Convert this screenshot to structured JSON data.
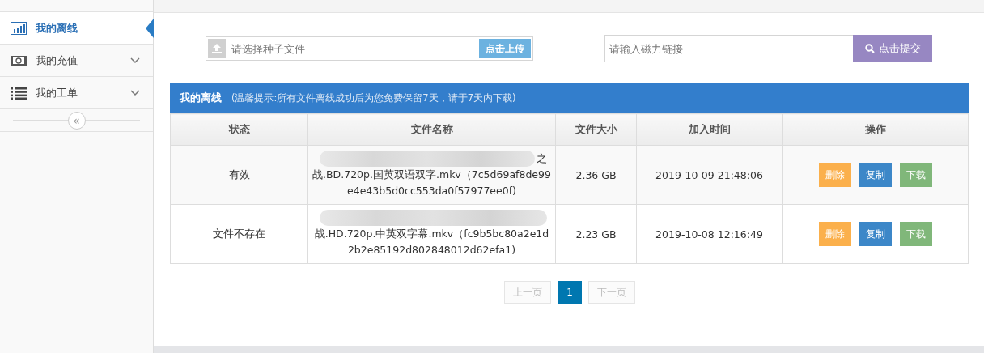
{
  "sidebar": {
    "items": [
      {
        "label": "我的离线",
        "kind": "chart",
        "selected": true,
        "expandable": false
      },
      {
        "label": "我的充值",
        "kind": "money",
        "selected": false,
        "expandable": true
      },
      {
        "label": "我的工单",
        "kind": "list",
        "selected": false,
        "expandable": true
      }
    ],
    "collapse": {
      "label": "«"
    }
  },
  "upload": {
    "placeholder": "请选择种子文件",
    "button": "点击上传"
  },
  "magnet": {
    "placeholder": "请输入磁力链接",
    "button": "点击提交"
  },
  "panel": {
    "title": "我的离线",
    "hint": "(温馨提示:所有文件离线成功后为您免费保留7天，请于7天内下载)"
  },
  "table": {
    "columns": [
      "状态",
      "文件名称",
      "文件大小",
      "加入时间",
      "操作"
    ],
    "rows": [
      {
        "status": "有效",
        "filename_line1_end": "之",
        "filename": "战.BD.720p.国英双语双字.mkv（7c5d69af8de99e4e43b5d0cc553da0f57977ee0f)",
        "size": "2.36 GB",
        "time": "2019-10-09 21:48:06",
        "actions": [
          {
            "kind": "delete",
            "label": "删除"
          },
          {
            "kind": "copy",
            "label": "复制"
          },
          {
            "kind": "download",
            "label": "下载"
          }
        ]
      },
      {
        "status": "文件不存在",
        "filename": "战.HD.720p.中英双字幕.mkv（fc9b5bc80a2e1d2b2e85192d802848012d62efa1)",
        "size": "2.23 GB",
        "time": "2019-10-08 12:16:49",
        "actions": [
          {
            "kind": "delete",
            "label": "删除"
          },
          {
            "kind": "copy",
            "label": "复制"
          },
          {
            "kind": "download",
            "label": "下载"
          }
        ]
      }
    ]
  },
  "pagination": {
    "prev": {
      "label": "上一页",
      "disabled": true
    },
    "pages": [
      {
        "label": "1",
        "selected": true
      }
    ],
    "next": {
      "label": "下一页",
      "disabled": true
    }
  }
}
